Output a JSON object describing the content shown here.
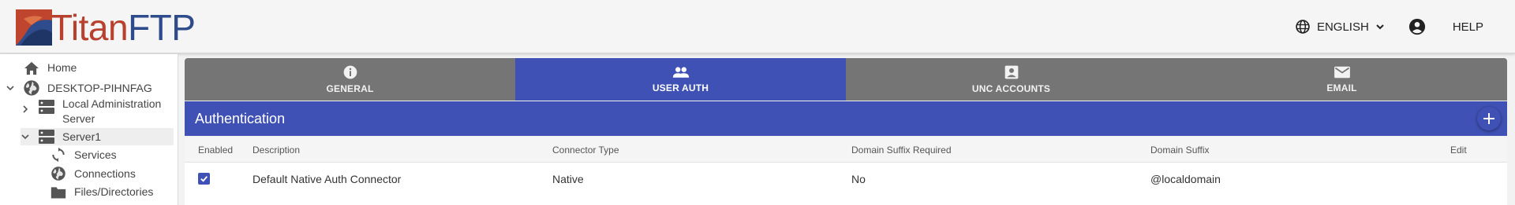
{
  "header": {
    "logo_text_a": "Titan",
    "logo_text_b": "FTP",
    "language_label": "ENGLISH",
    "help_label": "HELP"
  },
  "sidebar": {
    "items": [
      {
        "label": "Home",
        "icon": "home-icon"
      },
      {
        "label": "DESKTOP-PIHNFAG",
        "icon": "globe-icon"
      },
      {
        "label_line1": "Local Administration",
        "label_line2": "Server",
        "icon": "server-icon"
      },
      {
        "label": "Server1",
        "icon": "server-icon"
      },
      {
        "label": "Services",
        "icon": "sync-icon"
      },
      {
        "label": "Connections",
        "icon": "globe-icon"
      },
      {
        "label": "Files/Directories",
        "icon": "folder-icon"
      }
    ]
  },
  "tabs": [
    {
      "label": "GENERAL",
      "icon": "info-icon",
      "active": false
    },
    {
      "label": "USER AUTH",
      "icon": "people-icon",
      "active": true
    },
    {
      "label": "UNC ACCOUNTS",
      "icon": "account-box-icon",
      "active": false
    },
    {
      "label": "EMAIL",
      "icon": "mail-icon",
      "active": false
    }
  ],
  "auth": {
    "title": "Authentication"
  },
  "table": {
    "headers": {
      "enabled": "Enabled",
      "description": "Description",
      "connector_type": "Connector Type",
      "domain_suffix_required": "Domain Suffix Required",
      "domain_suffix": "Domain Suffix",
      "edit": "Edit"
    },
    "rows": [
      {
        "enabled": true,
        "description": "Default Native Auth Connector",
        "connector_type": "Native",
        "domain_suffix_required": "No",
        "domain_suffix": "@localdomain"
      }
    ]
  },
  "colors": {
    "primary": "#3f51b5",
    "tab_bar": "#757575",
    "logo_red": "#b8402e",
    "logo_blue": "#2e4b8c"
  }
}
